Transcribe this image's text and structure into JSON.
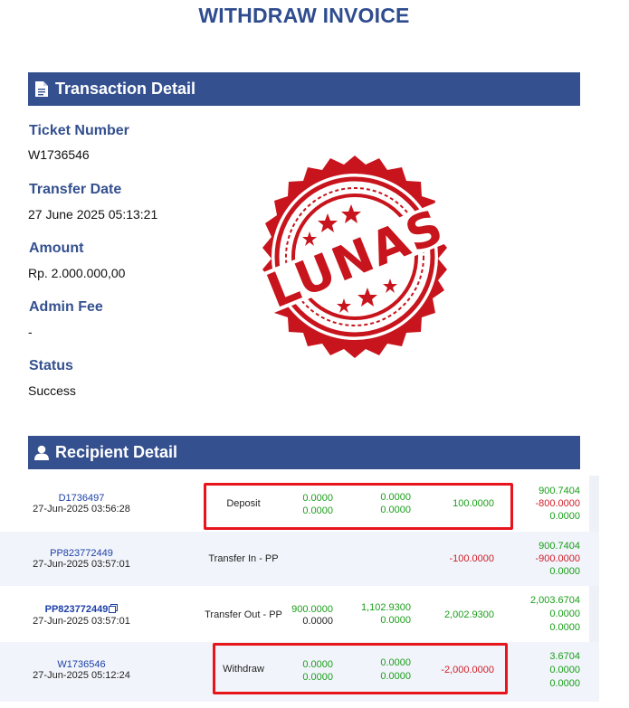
{
  "page": {
    "title": "WITHDRAW INVOICE"
  },
  "transaction_section": {
    "header": "Transaction Detail",
    "icon": "document-icon",
    "fields": [
      {
        "label": "Ticket Number",
        "value": "W1736546"
      },
      {
        "label": "Transfer Date",
        "value": "27 June 2025 05:13:21"
      },
      {
        "label": "Amount",
        "value": "Rp. 2.000.000,00"
      },
      {
        "label": "Admin Fee",
        "value": "-"
      },
      {
        "label": "Status",
        "value": "Success"
      }
    ]
  },
  "stamp": {
    "text": "LUNAS",
    "color": "#c8141c"
  },
  "recipient_section": {
    "header": "Recipient Detail",
    "icon": "user-icon"
  },
  "transactions": [
    {
      "id": "D1736497",
      "date": "27-Jun-2025 03:56:28",
      "type": "Deposit",
      "col1": [
        "0.0000",
        "0.0000"
      ],
      "col2": [
        "0.0000",
        "0.0000"
      ],
      "amount": "100.0000",
      "balance": [
        "900.7404",
        "-800.0000",
        "0.0000"
      ]
    },
    {
      "id": "PP823772449",
      "date": "27-Jun-2025 03:57:01",
      "type": "Transfer In - PP",
      "col1": [
        "",
        ""
      ],
      "col2": [
        "",
        ""
      ],
      "amount": "-100.0000",
      "balance": [
        "900.7404",
        "-900.0000",
        "0.0000"
      ]
    },
    {
      "id": "PP823772449",
      "date": "27-Jun-2025 03:57:01",
      "type": "Transfer Out - PP",
      "col1": [
        "900.0000",
        "0.0000"
      ],
      "col2": [
        "1,102.9300",
        "0.0000"
      ],
      "amount": "2,002.9300",
      "balance": [
        "2,003.6704",
        "0.0000",
        "0.0000"
      ]
    },
    {
      "id": "W1736546",
      "date": "27-Jun-2025 05:12:24",
      "type": "Withdraw",
      "col1": [
        "0.0000",
        "0.0000"
      ],
      "col2": [
        "0.0000",
        "0.0000"
      ],
      "amount": "-2,000.0000",
      "balance": [
        "3.6704",
        "0.0000",
        "0.0000"
      ]
    }
  ],
  "colors": {
    "header_bg": "#34508f",
    "label": "#34508f",
    "positive": "#1a9e1a",
    "negative": "#d0202a",
    "highlight": "#e8141c"
  }
}
